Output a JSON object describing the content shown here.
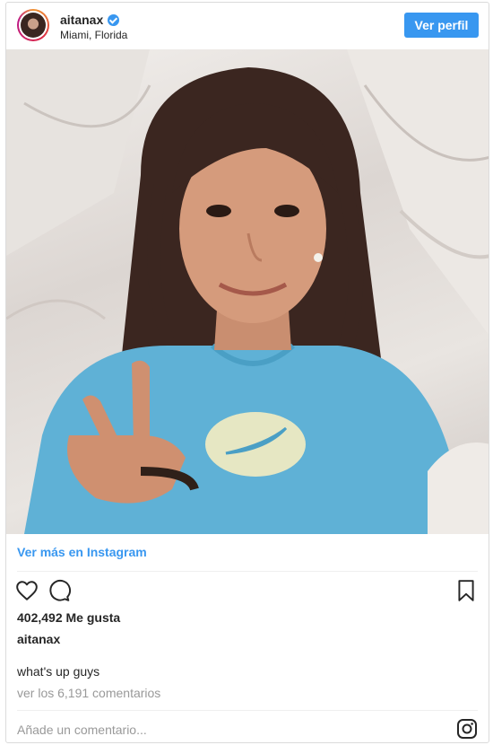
{
  "header": {
    "username": "aitanax",
    "location": "Miami, Florida",
    "profile_button": "Ver perfil"
  },
  "post": {
    "view_more": "Ver más en Instagram",
    "likes": "402,492 Me gusta",
    "caption_user": "aitanax",
    "caption": "what's up guys",
    "view_comments": "ver los 6,191 comentarios"
  },
  "comment": {
    "placeholder": "Añade un comentario..."
  },
  "icons": {
    "like": "heart-icon",
    "comment": "comment-bubble-icon",
    "save": "bookmark-icon",
    "brand": "instagram-icon",
    "verified": "verified-badge-icon"
  },
  "colors": {
    "accent": "#3897f0",
    "text": "#262626",
    "muted": "#999999",
    "border": "#dbdbdb"
  }
}
